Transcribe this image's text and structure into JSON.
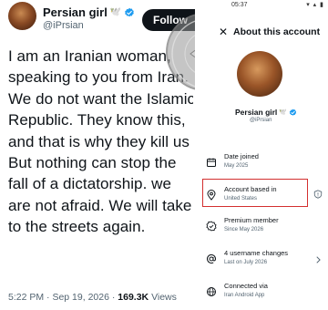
{
  "tweet": {
    "display_name": "Persian girl",
    "name_emoji": "🕊️",
    "handle": "@iPrsian",
    "follow_label": "Follow",
    "body": "I am an Iranian woman, speaking to you from Iran. We do not want the Islamic Republic. They know this, and that is why they kill us But nothing can stop the fall of a dictatorship. we are not afraid. We will take to the streets again.",
    "time": "5:22 PM",
    "date": "Sep 19, 2026",
    "views_count": "169.3K",
    "views_label": "Views",
    "verified_color": "#1d9bf0"
  },
  "status_bar": {
    "time": "05:37",
    "icons": "▾ ▴ ▮"
  },
  "about": {
    "title": "About this account",
    "display_name": "Persian girl",
    "name_emoji": "🕊️",
    "handle": "@iPrsian",
    "items": [
      {
        "icon": "calendar-icon",
        "label": "Date joined",
        "value": "May 2025"
      },
      {
        "icon": "location-pin-icon",
        "label": "Account based in",
        "value": "United States"
      },
      {
        "icon": "premium-star-icon",
        "label": "Premium member",
        "value": "Since May 2026"
      },
      {
        "icon": "at-sign-icon",
        "label": "4 username changes",
        "value": "Last on July 2026"
      },
      {
        "icon": "globe-icon",
        "label": "Connected via",
        "value": "Iran Android App"
      }
    ],
    "highlight_color": "#d32f2f"
  }
}
